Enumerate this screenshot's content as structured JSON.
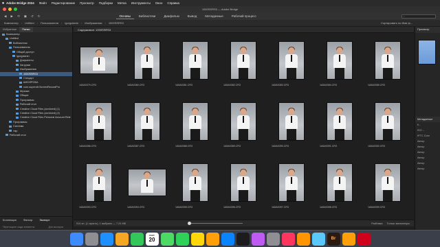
{
  "menubar": {
    "app": "Adobe Bridge 2024",
    "items": [
      "Файл",
      "Редактирование",
      "Просмотр",
      "Подборки",
      "Метка",
      "Инструменты",
      "Окно",
      "Справка"
    ],
    "clock": "Сб, 20 сент. 11:38"
  },
  "window_title": "1000SSRS3 — Adobe Bridge",
  "toolbar": {
    "workspaces": [
      "Основы",
      "Библиотеки",
      "Диафильм",
      "Вывод",
      "Метаданные",
      "Рабочий процесс"
    ],
    "active_workspace": "Основы"
  },
  "pathbar": {
    "crumbs": [
      "Компьютер",
      "Untitled",
      "Пользователи",
      "igorgulanin",
      "Изображения",
      "1000SSRS3"
    ],
    "sort_label": "Сортировать по Имя ф..."
  },
  "left_panel": {
    "tabs": [
      "Избранное",
      "Папки"
    ],
    "active_tab": "Папки",
    "tree": [
      {
        "label": "Компьютер",
        "indent": 0,
        "selected": false
      },
      {
        "label": "Untitled",
        "indent": 1,
        "selected": false
      },
      {
        "label": "Библиотека",
        "indent": 2,
        "selected": false
      },
      {
        "label": "Пользователи",
        "indent": 2,
        "selected": false
      },
      {
        "label": "Общий доступ",
        "indent": 3,
        "selected": false
      },
      {
        "label": "igorgulanin",
        "indent": 3,
        "selected": false
      },
      {
        "label": "Документы",
        "indent": 4,
        "selected": false
      },
      {
        "label": "Загрузки",
        "indent": 4,
        "selected": false
      },
      {
        "label": "Изображения",
        "indent": 4,
        "selected": false
      },
      {
        "label": "1000SSRS3",
        "indent": 5,
        "selected": true
      },
      {
        "label": "Спецарт",
        "indent": 5,
        "selected": false
      },
      {
        "label": "ШКОЛРОБА",
        "indent": 5,
        "selected": false
      },
      {
        "label": "com.superoft.ScreenRecordPro",
        "indent": 5,
        "selected": false
      },
      {
        "label": "Музыка",
        "indent": 4,
        "selected": false
      },
      {
        "label": "Общие",
        "indent": 4,
        "selected": false
      },
      {
        "label": "Программы",
        "indent": 4,
        "selected": false
      },
      {
        "label": "Рабочий стол",
        "indent": 4,
        "selected": false
      },
      {
        "label": "Creative Cloud Files (archived) (1)",
        "indent": 4,
        "selected": false
      },
      {
        "label": "Creative Cloud Files (archived) (2)",
        "indent": 4,
        "selected": false
      },
      {
        "label": "Creative Cloud Files Personal Account Rele",
        "indent": 4,
        "selected": false
      },
      {
        "label": "Программы",
        "indent": 2,
        "selected": false
      },
      {
        "label": "Система",
        "indent": 2,
        "selected": false
      },
      {
        "label": "тмр",
        "indent": 2,
        "selected": false
      },
      {
        "label": "Рабочий стол",
        "indent": 1,
        "selected": false
      }
    ],
    "bottom_tabs": [
      "Коллекции",
      "Фильтр",
      "Экспорт"
    ],
    "active_bottom_tab": "Экспорт",
    "bottom_footer": [
      "Перетащите сюда элементы",
      "Для экспорта"
    ]
  },
  "content": {
    "tab_label": "Содержимое: 1000SSRS3",
    "files": [
      {
        "name": "1A5A0379.CR3",
        "orient": "l"
      },
      {
        "name": "1A5A0380.CR3",
        "orient": "p"
      },
      {
        "name": "1A5A0381.CR3",
        "orient": "p"
      },
      {
        "name": "1A5A0382.CR3",
        "orient": "p"
      },
      {
        "name": "1A5A0383.CR3",
        "orient": "p"
      },
      {
        "name": "1A5A0384.CR3",
        "orient": "p"
      },
      {
        "name": "1A5A0385.CR3",
        "orient": "p"
      },
      {
        "name": "1A5A0386.CR3",
        "orient": "p"
      },
      {
        "name": "1A5A0387.CR3",
        "orient": "p"
      },
      {
        "name": "1A5A0388.CR3",
        "orient": "p"
      },
      {
        "name": "1A5A0389.CR3",
        "orient": "p"
      },
      {
        "name": "1A5A0390.CR3",
        "orient": "p"
      },
      {
        "name": "1A5A0391.CR3",
        "orient": "p"
      },
      {
        "name": "1A5A0392.CR3",
        "orient": "p"
      },
      {
        "name": "1A5A0393.CR3",
        "orient": "p"
      },
      {
        "name": "1A5A0394.CR3",
        "orient": "l"
      },
      {
        "name": "1A5A0395.CR3",
        "orient": "p"
      },
      {
        "name": "1A5A0396.CR3",
        "orient": "p"
      },
      {
        "name": "1A5A0397.CR3",
        "orient": "p"
      },
      {
        "name": "1A5A0398.CR3",
        "orient": "p"
      },
      {
        "name": "1A5A0399.CR3",
        "orient": "p"
      }
    ]
  },
  "status": {
    "text": "914 эл. (1 скрыто), 1 выбрано — 7.24 МБ",
    "right_items": [
      "Разбивка",
      "Только миниатюры"
    ]
  },
  "right_panel": {
    "preview_tab": "Просмотр",
    "meta_header": "Метаданные",
    "meta_rows": [
      "f/--",
      "ISO --",
      "IPTC Core",
      "Автор",
      "Автор",
      "Автор",
      "Автор",
      "Автор",
      "Автор"
    ]
  },
  "dock": [
    "Finder",
    "Launchpad",
    "Safari",
    "Photos",
    "Messages",
    "Calendar",
    "Maps",
    "FaceTime",
    "Notes",
    "Reminders",
    "App Store",
    "Apple TV",
    "Podcasts",
    "Settings",
    "Music",
    "Books",
    "Preview",
    "Bridge",
    "Infuse",
    "Screen"
  ]
}
